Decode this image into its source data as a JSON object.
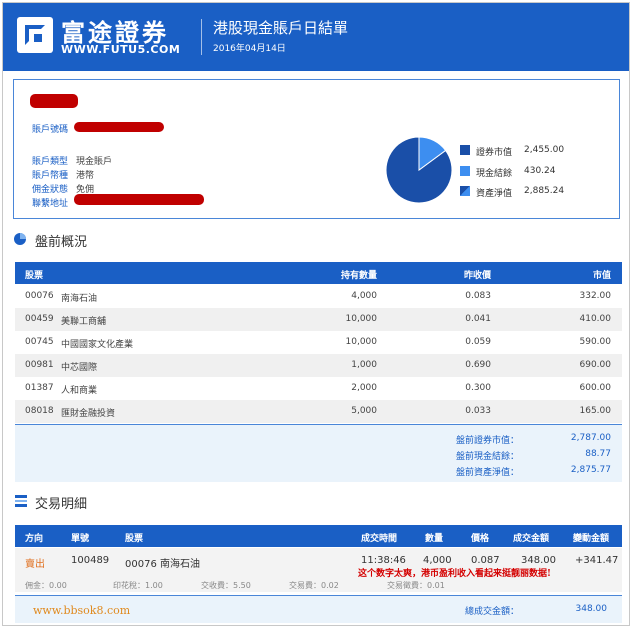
{
  "header": {
    "brand_cn": "富途證券",
    "brand_en": "WWW.FUTU5.COM",
    "title": "港股現金賬戶日結單",
    "date": "2016年04月14日"
  },
  "account": {
    "labels": [
      "賬戶號碼",
      "賬戶類型",
      "賬戶幣種",
      "佣金狀態",
      "聯繫地址"
    ],
    "type_value": "現金賬戶",
    "currency_value": "港幣",
    "commission_value": "免佣"
  },
  "legend": [
    {
      "label": "證券市值",
      "value": "2,455.00",
      "color": "#1a4fa8"
    },
    {
      "label": "現金結餘",
      "value": "430.24",
      "color": "#3d8ef0"
    },
    {
      "label": "資產淨值",
      "value": "2,885.24",
      "color": "#2366c8"
    }
  ],
  "chart_data": {
    "type": "pie",
    "slices": [
      {
        "label": "證券市值",
        "value": 2455.0
      },
      {
        "label": "現金結餘",
        "value": 430.24
      }
    ]
  },
  "holdings_section": {
    "title": "盤前概況",
    "headers": [
      "股票",
      "持有數量",
      "昨收價",
      "市值"
    ],
    "rows": [
      {
        "code": "00076",
        "name": "南海石油",
        "qty": "4,000",
        "prev": "0.083",
        "mv": "332.00"
      },
      {
        "code": "00459",
        "name": "美聯工商舖",
        "qty": "10,000",
        "prev": "0.041",
        "mv": "410.00"
      },
      {
        "code": "00745",
        "name": "中國國家文化產業",
        "qty": "10,000",
        "prev": "0.059",
        "mv": "590.00"
      },
      {
        "code": "00981",
        "name": "中芯國際",
        "qty": "1,000",
        "prev": "0.690",
        "mv": "690.00"
      },
      {
        "code": "01387",
        "name": "人和商業",
        "qty": "2,000",
        "prev": "0.300",
        "mv": "600.00"
      },
      {
        "code": "08018",
        "name": "匯財金融投資",
        "qty": "5,000",
        "prev": "0.033",
        "mv": "165.00"
      }
    ],
    "summary": [
      {
        "label": "盤前證券市值：",
        "value": "2,787.00"
      },
      {
        "label": "盤前現金結餘：",
        "value": "88.77"
      },
      {
        "label": "盤前資產淨值：",
        "value": "2,875.77"
      }
    ]
  },
  "trade_section": {
    "title": "交易明細",
    "headers": [
      "方向",
      "單號",
      "股票",
      "成交時間",
      "數量",
      "價格",
      "成交金額",
      "變動金額"
    ],
    "row": {
      "direction": "賣出",
      "order_no": "100489",
      "stock": "00076  南海石油",
      "time": "11:38:46",
      "qty": "4,000",
      "price": "0.087",
      "amount": "348.00",
      "change": "+341.47"
    },
    "fees": [
      "佣金：0.00",
      "印花稅：1.00",
      "交收費：5.50",
      "交易費：0.02",
      "交易徵費：0.01"
    ],
    "total_label": "總成交金額：",
    "total_value": "348.00"
  },
  "annotation": "这个数字太爽，港币盈利收入看起来挺靓丽数据!",
  "watermark": "www.bbsok8.com"
}
